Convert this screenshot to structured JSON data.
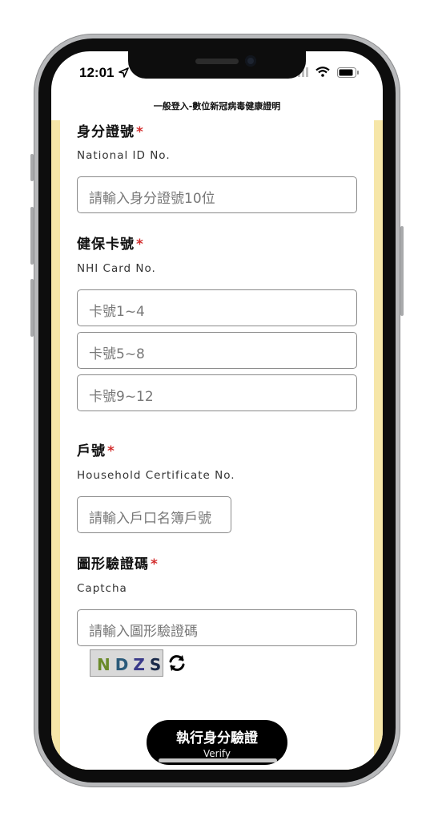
{
  "status_bar": {
    "time": "12:01"
  },
  "header": {
    "title": "一般登入-數位新冠病毒健康證明"
  },
  "national_id": {
    "label_cn": "身分證號",
    "required_mark": "*",
    "label_en": "National ID No.",
    "placeholder": "請輸入身分證號10位"
  },
  "nhi_card": {
    "label_cn": "健保卡號",
    "required_mark": "*",
    "label_en": "NHI Card No.",
    "placeholders": [
      "卡號1~4",
      "卡號5~8",
      "卡號9~12"
    ]
  },
  "household": {
    "label_cn": "戶號",
    "required_mark": "*",
    "label_en": "Household Certificate No.",
    "placeholder": "請輸入戶口名簿戶號"
  },
  "captcha": {
    "label_cn": "圖形驗證碼",
    "required_mark": "*",
    "label_en": "Captcha",
    "placeholder": "請輸入圖形驗證碼",
    "image_chars": [
      "N",
      "D",
      "Z",
      "S"
    ]
  },
  "verify_button": {
    "label_cn": "執行身分驗證",
    "label_en": "Verify"
  },
  "colors": {
    "side_band": "#f6e6a8",
    "required": "#d32f2f",
    "button": "#000000"
  },
  "icons": [
    "location-arrow-icon",
    "signal-icon",
    "wifi-icon",
    "battery-icon",
    "refresh-icon"
  ]
}
